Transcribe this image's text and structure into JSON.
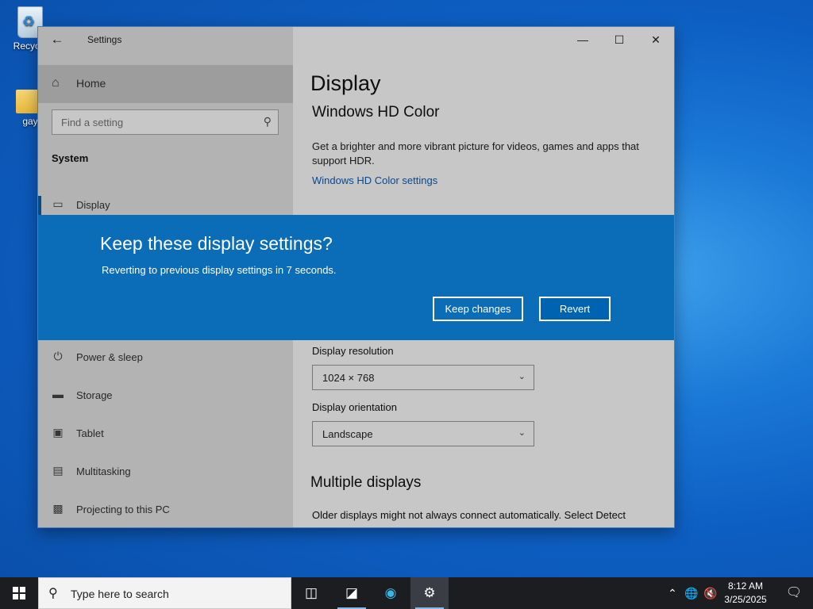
{
  "desktop": {
    "icons": [
      {
        "label": "Recycle"
      },
      {
        "label": "gay"
      }
    ]
  },
  "window": {
    "title": "Settings",
    "sidebar": {
      "home_label": "Home",
      "search_placeholder": "Find a setting",
      "section": "System",
      "items": [
        {
          "label": "Display",
          "icon": "monitor-icon"
        },
        {
          "label": "Power & sleep",
          "icon": "power-icon"
        },
        {
          "label": "Storage",
          "icon": "storage-icon"
        },
        {
          "label": "Tablet",
          "icon": "tablet-icon"
        },
        {
          "label": "Multitasking",
          "icon": "multitasking-icon"
        },
        {
          "label": "Projecting to this PC",
          "icon": "projecting-icon"
        }
      ]
    },
    "content": {
      "page_title": "Display",
      "hdr_heading": "Windows HD Color",
      "hdr_desc": "Get a brighter and more vibrant picture for videos, games and apps that support HDR.",
      "hdr_link": "Windows HD Color settings",
      "resolution_label": "Display resolution",
      "resolution_value": "1024 × 768",
      "orientation_label": "Display orientation",
      "orientation_value": "Landscape",
      "multiple_heading": "Multiple displays",
      "multiple_desc": "Older displays might not always connect automatically. Select Detect"
    }
  },
  "dialog": {
    "title": "Keep these display settings?",
    "message": "Reverting to previous display settings in  7 seconds.",
    "keep_label": "Keep changes",
    "revert_label": "Revert"
  },
  "taskbar": {
    "search_placeholder": "Type here to search",
    "time": "8:12 AM",
    "date": "3/25/2025"
  }
}
